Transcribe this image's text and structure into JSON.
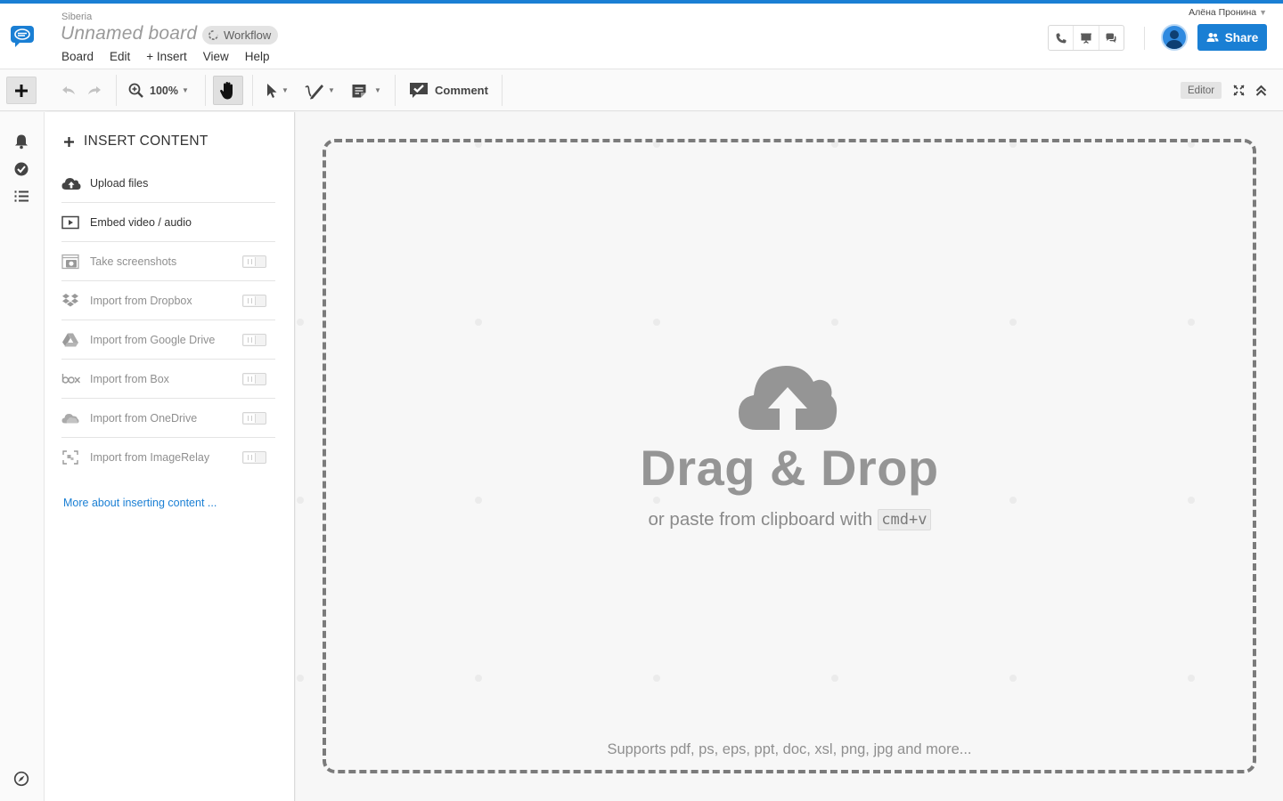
{
  "header": {
    "organization": "Siberia",
    "board_title": "Unnamed board",
    "workflow_badge": "Workflow",
    "user_name": "Алёна Пронина",
    "share_label": "Share",
    "menu": [
      "Board",
      "Edit",
      "+ Insert",
      "View",
      "Help"
    ]
  },
  "toolbar": {
    "zoom": "100%",
    "comment_label": "Comment",
    "mode_badge": "Editor"
  },
  "panel": {
    "title": "INSERT CONTENT",
    "items": [
      {
        "label": "Upload files",
        "icon": "cloud-upload-icon",
        "enabled": true
      },
      {
        "label": "Embed video / audio",
        "icon": "video-play-icon",
        "enabled": true
      },
      {
        "label": "Take screenshots",
        "icon": "camera-icon",
        "enabled": false
      },
      {
        "label": "Import from Dropbox",
        "icon": "dropbox-icon",
        "enabled": false
      },
      {
        "label": "Import from Google Drive",
        "icon": "google-drive-icon",
        "enabled": false
      },
      {
        "label": "Import from Box",
        "icon": "box-logo-icon",
        "enabled": false
      },
      {
        "label": "Import from OneDrive",
        "icon": "onedrive-icon",
        "enabled": false
      },
      {
        "label": "Import from ImageRelay",
        "icon": "imagerelay-icon",
        "enabled": false
      }
    ],
    "more_link": "More about inserting content ..."
  },
  "canvas": {
    "drop_title": "Drag & Drop",
    "paste_text": "or paste from clipboard with",
    "shortcut": "cmd+v",
    "supports": "Supports pdf, ps, eps, ppt, doc, xsl, png, jpg and more..."
  },
  "colors": {
    "accent": "#1a7fd4",
    "drop_text": "#959595",
    "dashed_border": "#7b7b7b"
  }
}
